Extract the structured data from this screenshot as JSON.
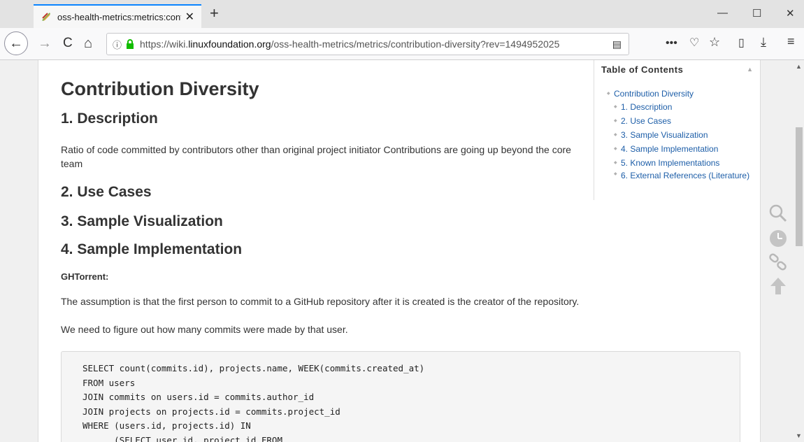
{
  "browser": {
    "tab_title": "oss-health-metrics:metrics:cont",
    "url_prefix": "https://wiki.",
    "url_host": "linuxfoundation.org",
    "url_path": "/oss-health-metrics/metrics/contribution-diversity?rev=1494952025",
    "icons": {
      "tab_close": "close-icon",
      "new_tab": "plus-icon",
      "minimize": "minimize-icon",
      "maximize": "maximize-icon",
      "close_window": "close-icon",
      "back": "arrow-left-icon",
      "forward": "arrow-right-icon",
      "reload": "reload-icon",
      "home": "home-icon",
      "reader_view": "reader-view-icon",
      "more": "more-icon",
      "pocket": "pocket-icon",
      "bookmark": "star-icon",
      "library": "library-icon",
      "downloads": "download-icon",
      "menu": "hamburger-icon"
    }
  },
  "page": {
    "title": "Contribution Diversity",
    "sections": {
      "description_heading": "1. Description",
      "description_text": "Ratio of code committed by contributors other than original project initiator Contributions are going up beyond the core team",
      "use_cases_heading": "2. Use Cases",
      "sample_viz_heading": "3. Sample Visualization",
      "sample_impl_heading": "4. Sample Implementation",
      "ghtorrent_label": "GHTorrent:",
      "assumption_text": "The assumption is that the first person to commit to a GitHub repository after it is created is the creator of the repository.",
      "figure_out_text": "We need to figure out how many commits were made by that user."
    },
    "code_lines": [
      "SELECT count(commits.id), projects.name, WEEK(commits.created_at)",
      "FROM users",
      "JOIN commits on users.id = commits.author_id",
      "JOIN projects on projects.id = commits.project_id",
      "WHERE (users.id, projects.id) IN",
      "      (SELECT user_id, project_id FROM"
    ]
  },
  "toc": {
    "title": "Table of Contents",
    "items": [
      "Contribution Diversity",
      "1. Description",
      "2. Use Cases",
      "3. Sample Visualization",
      "4. Sample Implementation",
      "5. Known Implementations",
      "6. External References (Literature)"
    ]
  },
  "side_tools": [
    "search-icon",
    "clock-icon",
    "link-icon",
    "arrow-up-icon"
  ]
}
